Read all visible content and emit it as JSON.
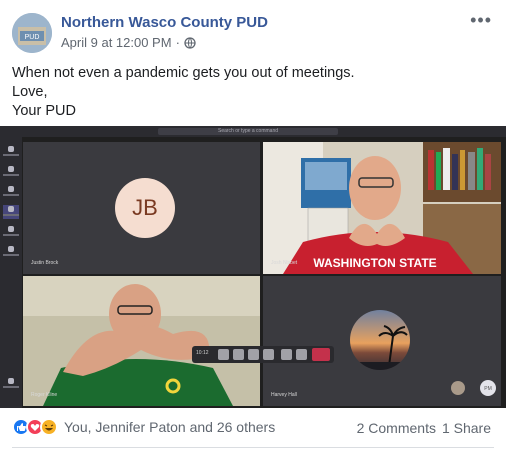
{
  "post": {
    "page_name": "Northern Wasco County PUD",
    "timestamp": "April 9 at 12:00 PM",
    "separator": "·",
    "more_label": "•••",
    "text_lines": [
      "When not even a pandemic gets you out of meetings.",
      "Love,",
      "Your PUD"
    ]
  },
  "teams": {
    "search_placeholder": "Search or type a command",
    "tiles": [
      {
        "name": "Justin Brock",
        "initials": "JB"
      },
      {
        "name": "Josh Nisbet"
      },
      {
        "name": "Roger Kline"
      },
      {
        "name": "Harvey Hall"
      }
    ],
    "call_timer": "10:12",
    "corner_avatar_initials": "PM",
    "colors": {
      "initials_bg": "#f5ddd0",
      "hangup": "#c4314b",
      "accent": "#6264a7"
    }
  },
  "footer": {
    "reactions": [
      "like-icon",
      "love-icon",
      "haha-icon"
    ],
    "reaction_label": "You, Jennifer Paton and 26 others",
    "comments": "2 Comments",
    "shares": "1 Share"
  }
}
